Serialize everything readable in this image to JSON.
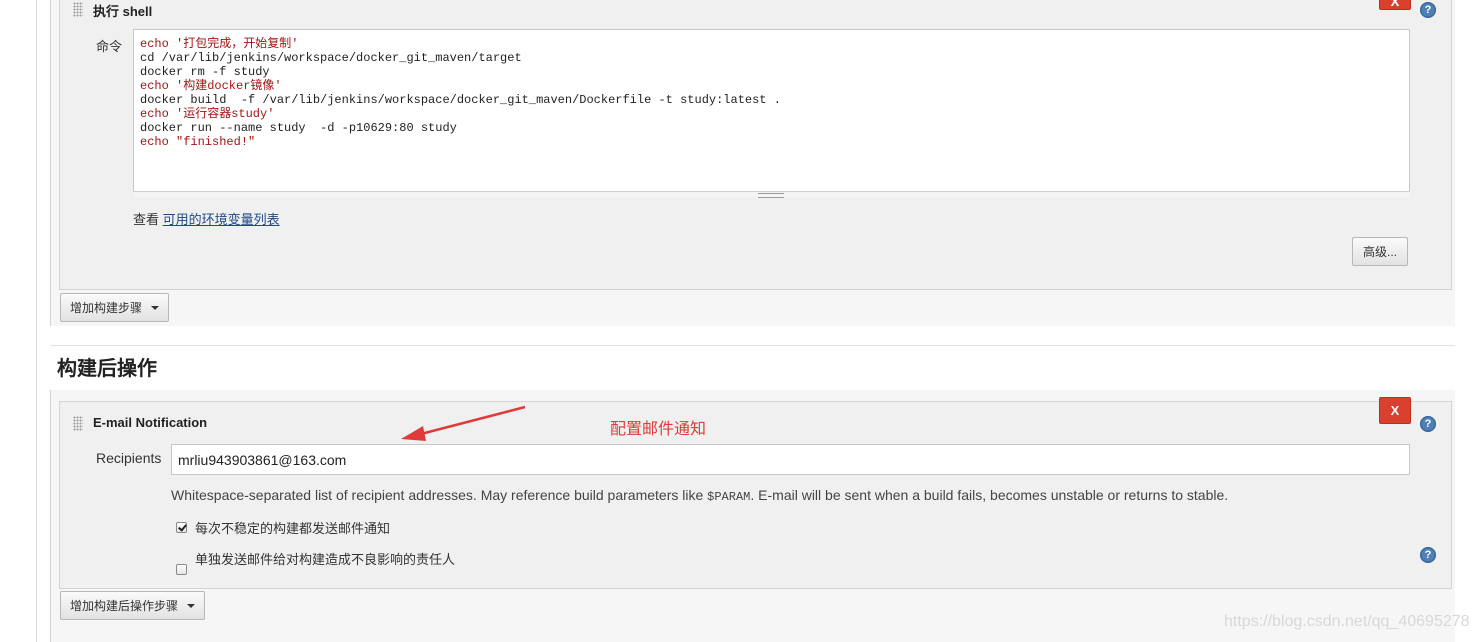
{
  "build_step": {
    "title": "执行 shell",
    "command_label": "命令",
    "command_lines": [
      "echo '打包完成，开始复制'",
      "cd /var/lib/jenkins/workspace/docker_git_maven/target",
      "docker rm -f study",
      "echo '构建docker镜像'",
      "docker build  -f /var/lib/jenkins/workspace/docker_git_maven/Dockerfile -t study:latest .",
      "echo '运行容器study'",
      "docker run --name study  -d -p10629:80 study",
      "echo \"finished!\""
    ],
    "env_prefix": "查看 ",
    "env_link": "可用的环境变量列表",
    "advanced_button": "高级...",
    "delete_label": "X",
    "help_label": "?"
  },
  "add_build_step_button": "增加构建步骤",
  "post_build": {
    "heading": "构建后操作",
    "email": {
      "title": "E-mail Notification",
      "delete_label": "X",
      "help_label": "?",
      "recipients_label": "Recipients",
      "recipients_value": "mrliu943903861@163.com",
      "hint_before": "Whitespace-separated list of recipient addresses. May reference build parameters like ",
      "hint_param": "$PARAM",
      "hint_after": ". E-mail will be sent when a build fails, becomes unstable or returns to stable.",
      "checkbox_unstable_label": "每次不稳定的构建都发送邮件通知",
      "checkbox_unstable_checked": true,
      "checkbox_individuals_label": "单独发送邮件给对构建造成不良影响的责任人",
      "checkbox_individuals_checked": false,
      "checkbox_help_label": "?"
    },
    "add_post_build_button": "增加构建后操作步骤"
  },
  "annotation": {
    "text": "配置邮件通知",
    "color": "#e03b3b"
  },
  "watermark": "https://blog.csdn.net/qq_40695278",
  "colors": {
    "delete_button": "#d9412e",
    "help_icon": "#4f7fb5",
    "link": "#204a87"
  }
}
